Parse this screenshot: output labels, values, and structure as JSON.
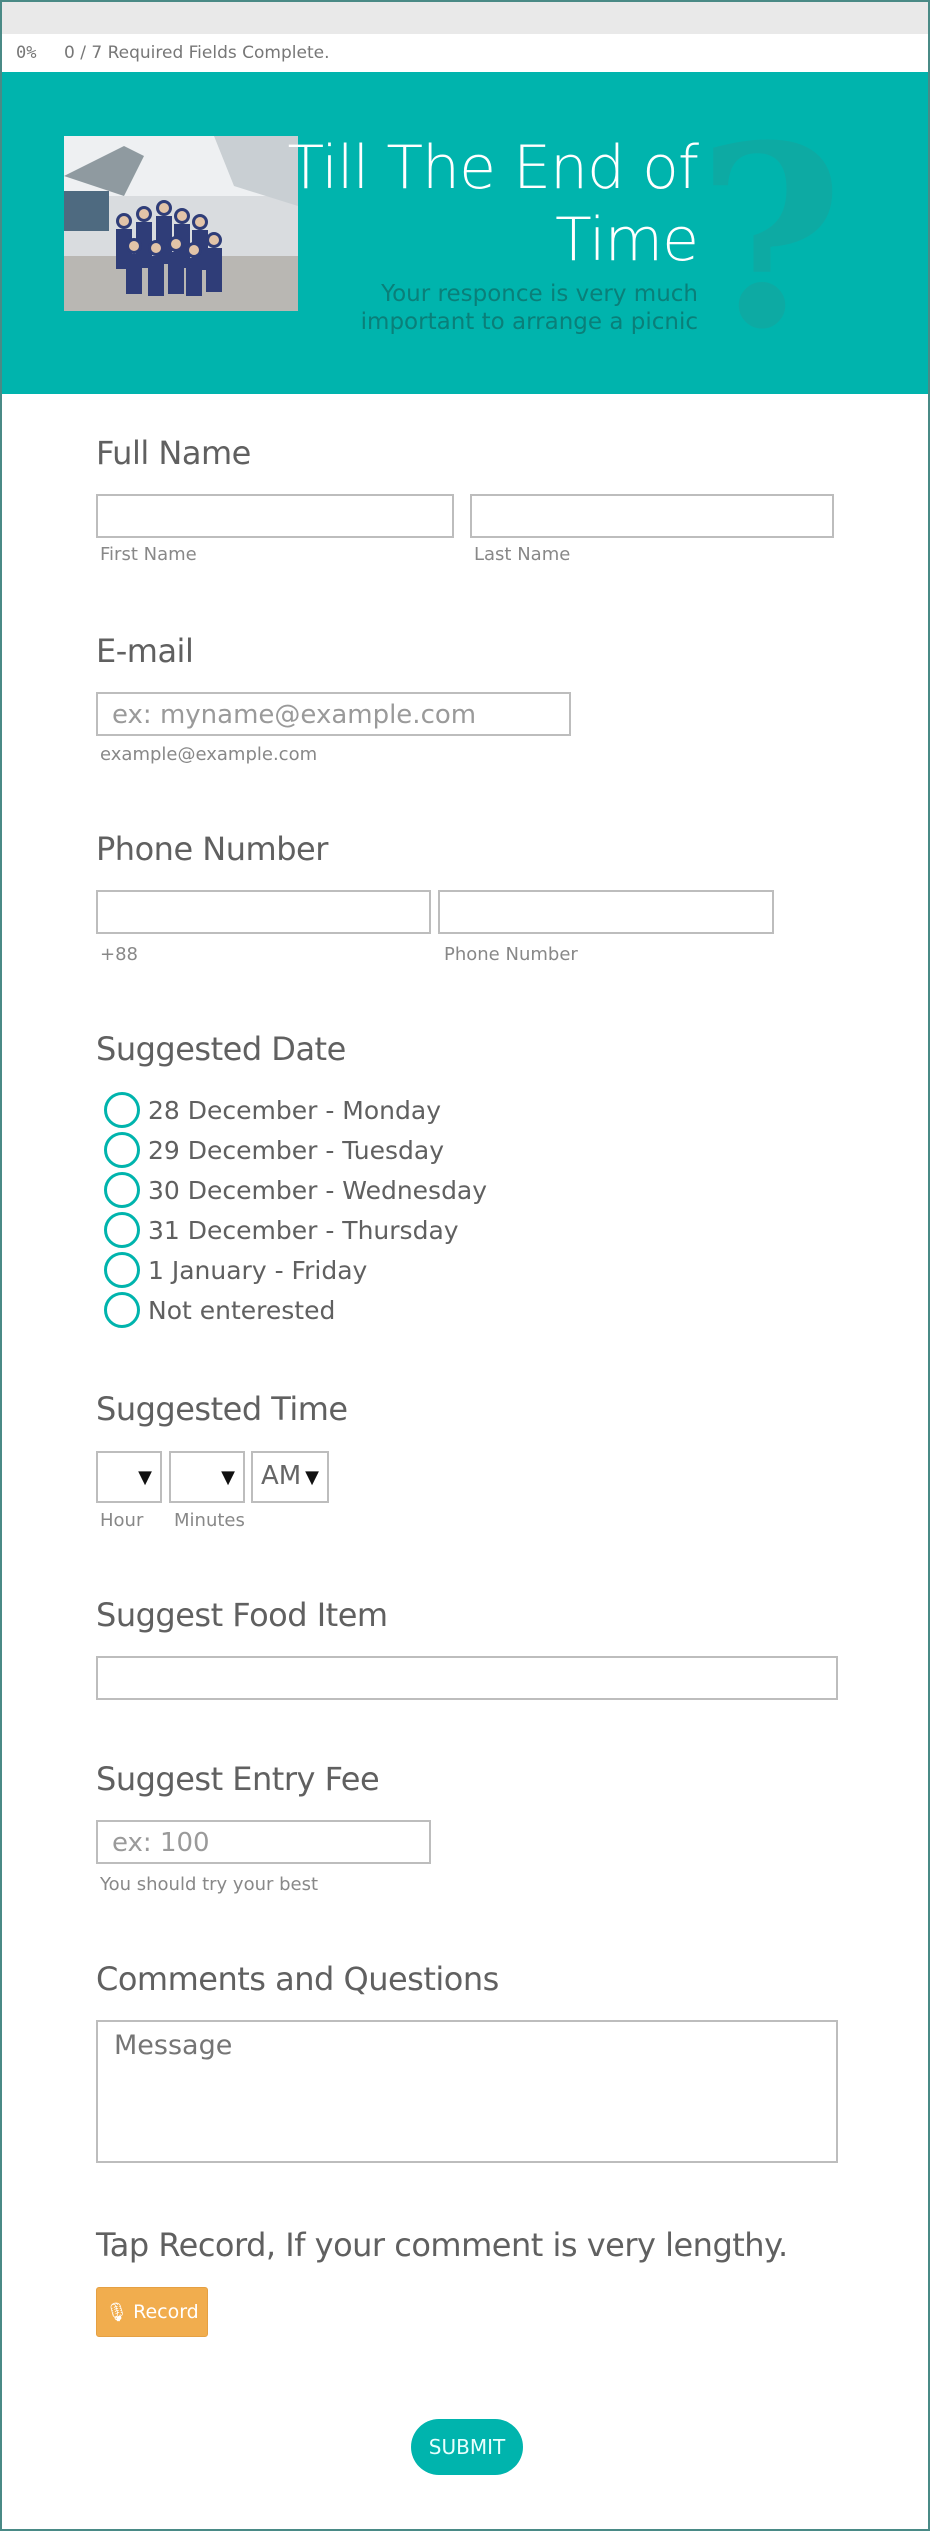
{
  "progress": {
    "percent": "0%",
    "required_text": "0 / 7 Required Fields Complete."
  },
  "header": {
    "title": "Till The End of Time",
    "subtitle": "Your responce is very much important to arrange a picnic",
    "decor_glyph": "?",
    "brand_color": "#00b4ad"
  },
  "form": {
    "full_name": {
      "label": "Full Name",
      "first_value": "",
      "last_value": "",
      "first_sublabel": "First Name",
      "last_sublabel": "Last Name"
    },
    "email": {
      "label": "E-mail",
      "placeholder": "ex: myname@example.com",
      "sublabel": "example@example.com"
    },
    "phone": {
      "label": "Phone Number",
      "code_value": "",
      "number_value": "",
      "code_sublabel": "+88",
      "number_sublabel": "Phone Number"
    },
    "date": {
      "label": "Suggested Date",
      "options": [
        "28 December - Monday",
        "29 December - Tuesday",
        "30 December - Wednesday",
        "31 December - Thursday",
        "1 January - Friday",
        "Not enterested"
      ]
    },
    "time": {
      "label": "Suggested Time",
      "hour_value": "",
      "minute_value": "",
      "ampm_value": "AM",
      "hour_sublabel": "Hour",
      "minute_sublabel": "Minutes"
    },
    "food": {
      "label": "Suggest Food Item",
      "value": ""
    },
    "fee": {
      "label": "Suggest Entry Fee",
      "placeholder": "ex: 100",
      "sublabel": "You should try your best"
    },
    "comments": {
      "label": "Comments and Questions",
      "placeholder": "Message"
    },
    "record": {
      "label": "Tap Record, If your comment is very lengthy.",
      "button_label": "Record",
      "button_color": "#f1ad4e"
    },
    "submit_label": "SUBMIT"
  }
}
